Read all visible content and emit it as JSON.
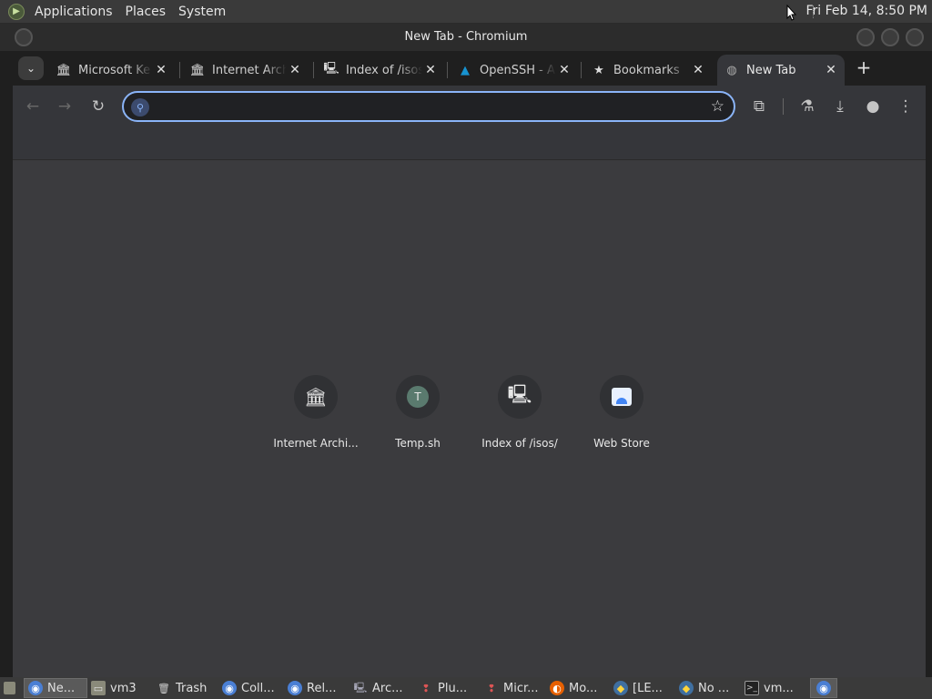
{
  "system_panel": {
    "menus": [
      "Applications",
      "Places",
      "System"
    ],
    "clock": "Fri Feb 14,  8:50 PM"
  },
  "window": {
    "title": "New Tab - Chromium"
  },
  "tabs": [
    {
      "label": "Microsoft Ke",
      "icon": "museum-icon"
    },
    {
      "label": "Internet Arch",
      "icon": "museum-icon"
    },
    {
      "label": "Index of /isos",
      "icon": "server-icon"
    },
    {
      "label": "OpenSSH - A",
      "icon": "arch-icon"
    },
    {
      "label": "Bookmarks",
      "icon": "star-icon"
    },
    {
      "label": "New Tab",
      "icon": "globe-icon"
    }
  ],
  "omnibox": {
    "value": "",
    "placeholder": ""
  },
  "shortcuts": [
    {
      "title": "Internet Archi...",
      "icon": "museum-icon",
      "glyph": "🏛"
    },
    {
      "title": "Temp.sh",
      "icon": "letter-t-icon",
      "glyph": "T"
    },
    {
      "title": "Index of /isos/",
      "icon": "server-icon",
      "glyph": "🖳"
    },
    {
      "title": "Web Store",
      "icon": "web-store-icon",
      "glyph": "🛍"
    }
  ],
  "taskbar": {
    "items": [
      {
        "label": "Ne...",
        "icon": "chromium-icon"
      },
      {
        "label": "vm3",
        "icon": "folder-icon"
      },
      {
        "label": "Trash",
        "icon": "trash-icon"
      },
      {
        "label": "Coll...",
        "icon": "chromium-icon"
      },
      {
        "label": "Rel...",
        "icon": "chromium-icon"
      },
      {
        "label": "Arc...",
        "icon": "archive-icon"
      },
      {
        "label": "Plu...",
        "icon": "pin-icon"
      },
      {
        "label": "Micr...",
        "icon": "pin-icon"
      },
      {
        "label": "Mo...",
        "icon": "firefox-icon"
      },
      {
        "label": "[LE...",
        "icon": "python-icon"
      },
      {
        "label": "No ...",
        "icon": "python-icon"
      },
      {
        "label": "vm...",
        "icon": "terminal-icon"
      }
    ]
  },
  "colors": {
    "accent": "#8ab4f8",
    "toolbar_bg": "#35363a",
    "content_bg": "#3b3b3e"
  }
}
